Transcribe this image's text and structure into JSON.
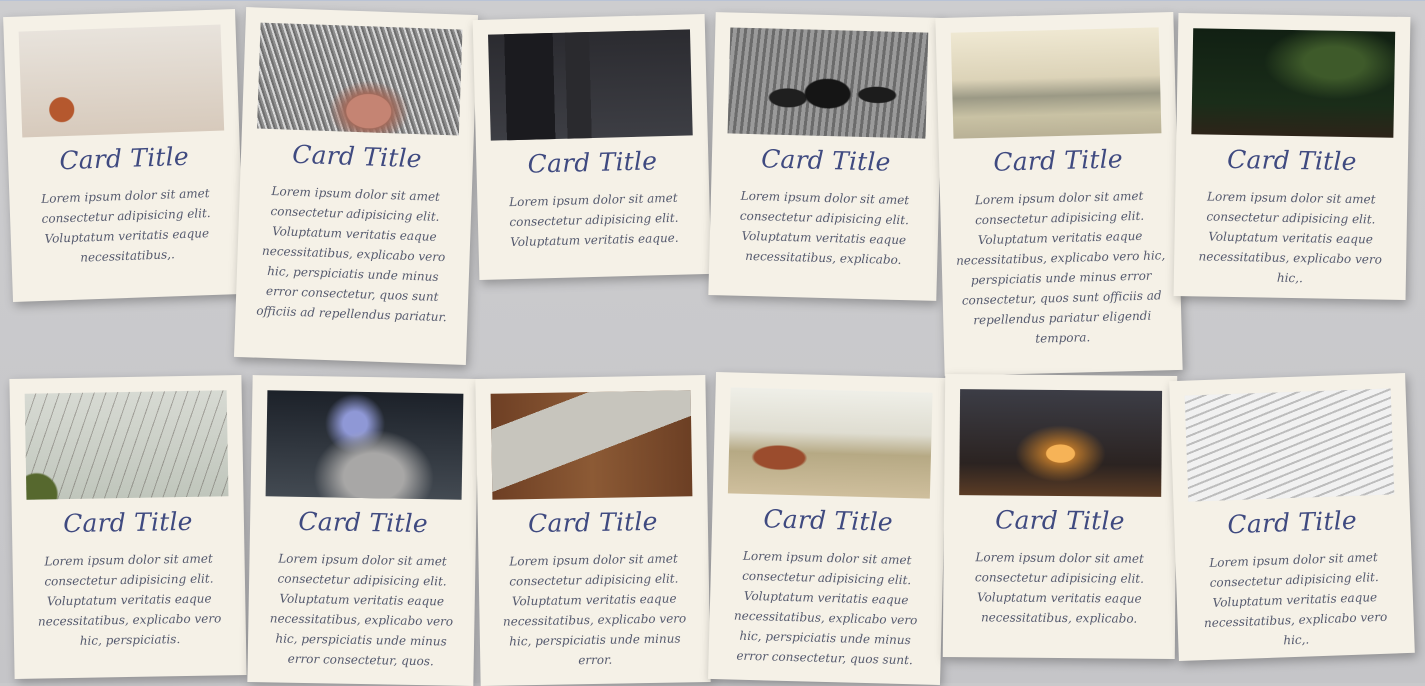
{
  "cards": [
    {
      "title": "Card Title",
      "text": "Lorem ipsum dolor sit amet consectetur adipisicing elit. Voluptatum veritatis eaque necessitatibus,.",
      "image": "desk-workspace-photo"
    },
    {
      "title": "Card Title",
      "text": "Lorem ipsum dolor sit amet consectetur adipisicing elit. Voluptatum veritatis eaque necessitatibus, explicabo vero hic, perspiciatis unde minus error consectetur, quos sunt officiis ad repellendus pariatur.",
      "image": "cat-nose-photo"
    },
    {
      "title": "Card Title",
      "text": "Lorem ipsum dolor sit amet consectetur adipisicing elit. Voluptatum veritatis eaque.",
      "image": "tech-gadgets-photo"
    },
    {
      "title": "Card Title",
      "text": "Lorem ipsum dolor sit amet consectetur adipisicing elit. Voluptatum veritatis eaque necessitatibus, explicabo.",
      "image": "pine-cones-photo"
    },
    {
      "title": "Card Title",
      "text": "Lorem ipsum dolor sit amet consectetur adipisicing elit. Voluptatum veritatis eaque necessitatibus, explicabo vero hic, perspiciatis unde minus error consectetur, quos sunt officiis ad repellendus pariatur eligendi tempora.",
      "image": "beach-photo"
    },
    {
      "title": "Card Title",
      "text": "Lorem ipsum dolor sit amet consectetur adipisicing elit. Voluptatum veritatis eaque necessitatibus, explicabo vero hic,.",
      "image": "night-sky-photo"
    },
    {
      "title": "Card Title",
      "text": "Lorem ipsum dolor sit amet consectetur adipisicing elit. Voluptatum veritatis eaque necessitatibus, explicabo vero hic, perspiciatis.",
      "image": "bare-tree-photo"
    },
    {
      "title": "Card Title",
      "text": "Lorem ipsum dolor sit amet consectetur adipisicing elit. Voluptatum veritatis eaque necessitatibus, explicabo vero hic, perspiciatis unde minus error consectetur, quos.",
      "image": "phone-photo"
    },
    {
      "title": "Card Title",
      "text": "Lorem ipsum dolor sit amet consectetur adipisicing elit. Voluptatum veritatis eaque necessitatibus, explicabo vero hic, perspiciatis unde minus error.",
      "image": "laptop-notebook-photo"
    },
    {
      "title": "Card Title",
      "text": "Lorem ipsum dolor sit amet consectetur adipisicing elit. Voluptatum veritatis eaque necessitatibus, explicabo vero hic, perspiciatis unde minus error consectetur, quos sunt.",
      "image": "highland-cow-photo"
    },
    {
      "title": "Card Title",
      "text": "Lorem ipsum dolor sit amet consectetur adipisicing elit. Voluptatum veritatis eaque necessitatibus, explicabo.",
      "image": "night-road-photo"
    },
    {
      "title": "Card Title",
      "text": "Lorem ipsum dolor sit amet consectetur adipisicing elit. Voluptatum veritatis eaque necessitatibus, explicabo vero hic,.",
      "image": "stone-stairs-photo"
    }
  ]
}
